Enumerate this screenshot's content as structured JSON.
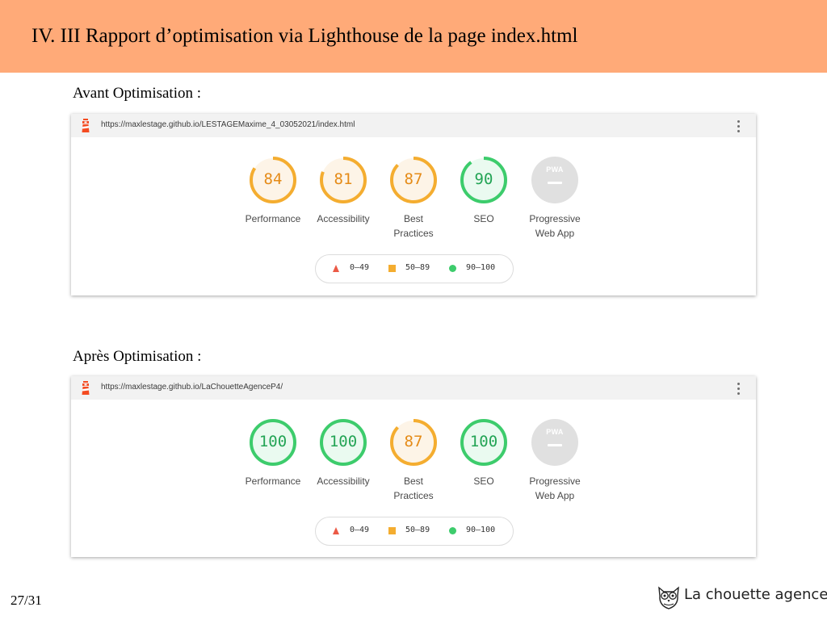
{
  "slide": {
    "title": "IV. III Rapport d’optimisation via Lighthouse de la page index.html",
    "page_number": "27/31",
    "brand": {
      "name": "La chouette agence",
      "icon": "owl-icon"
    }
  },
  "colors": {
    "header_bg": "#ffaa78",
    "score_average": "#f4ad30",
    "score_pass": "#3dcc6c",
    "score_fail": "#eb5a46",
    "pwa_gray": "#e0e0e0"
  },
  "reports": [
    {
      "label": "Avant Optimisation :",
      "url": "https://maxlestage.github.io/LESTAGEMaxime_4_03052021/index.html",
      "gauges": [
        {
          "label": "Performance",
          "score": "84",
          "value": 84,
          "status": "average"
        },
        {
          "label": "Accessibility",
          "score": "81",
          "value": 81,
          "status": "average"
        },
        {
          "label": "Best\nPractices",
          "score": "87",
          "value": 87,
          "status": "average"
        },
        {
          "label": "SEO",
          "score": "90",
          "value": 90,
          "status": "pass"
        },
        {
          "label": "Progressive\nWeb App",
          "score": "PWA",
          "status": "pwa"
        }
      ],
      "legend": [
        {
          "range": "0–49",
          "shape": "triangle",
          "status": "fail"
        },
        {
          "range": "50–89",
          "shape": "square",
          "status": "average"
        },
        {
          "range": "90–100",
          "shape": "circle",
          "status": "pass"
        }
      ]
    },
    {
      "label": "Après Optimisation :",
      "url": "https://maxlestage.github.io/LaChouetteAgenceP4/",
      "gauges": [
        {
          "label": "Performance",
          "score": "100",
          "value": 100,
          "status": "pass"
        },
        {
          "label": "Accessibility",
          "score": "100",
          "value": 100,
          "status": "pass"
        },
        {
          "label": "Best\nPractices",
          "score": "87",
          "value": 87,
          "status": "average"
        },
        {
          "label": "SEO",
          "score": "100",
          "value": 100,
          "status": "pass"
        },
        {
          "label": "Progressive\nWeb App",
          "score": "PWA",
          "status": "pwa"
        }
      ],
      "legend": [
        {
          "range": "0–49",
          "shape": "triangle",
          "status": "fail"
        },
        {
          "range": "50–89",
          "shape": "square",
          "status": "average"
        },
        {
          "range": "90–100",
          "shape": "circle",
          "status": "pass"
        }
      ]
    }
  ]
}
